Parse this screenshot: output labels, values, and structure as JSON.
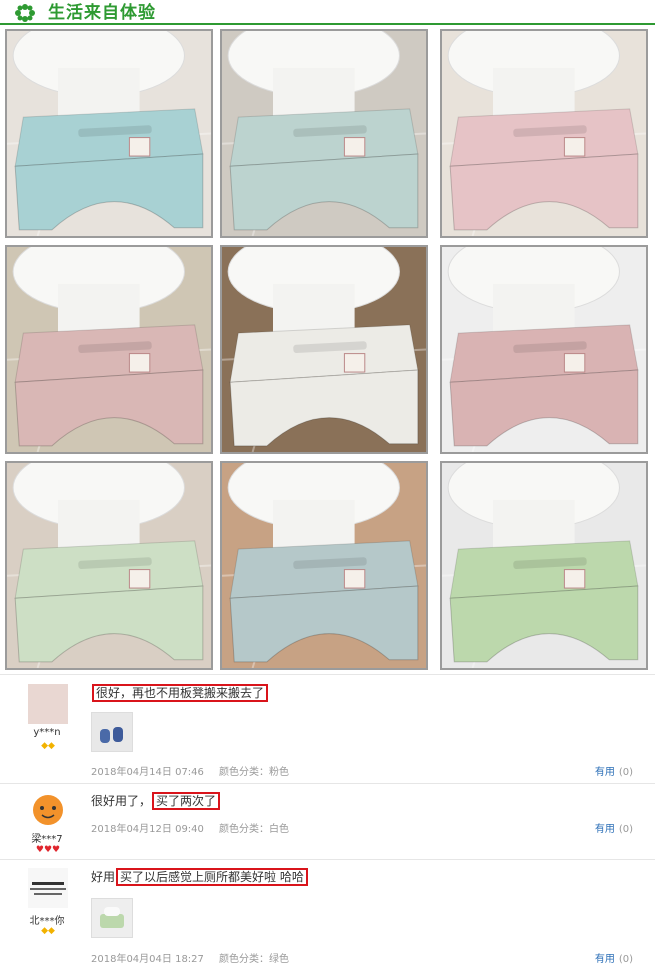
{
  "header": {
    "title": "生活来自体验",
    "accent": "#2e9a32"
  },
  "photos": [
    {
      "stool_color": "#a8d1d3",
      "floor": "#e7e2dc"
    },
    {
      "stool_color": "#bcd3cf",
      "floor": "#cfcac2"
    },
    {
      "stool_color": "#e6c3c6",
      "floor": "#e8e2da"
    },
    {
      "stool_color": "#d9b7b5",
      "floor": "#cfc6b4"
    },
    {
      "stool_color": "#ecebe6",
      "floor": "#8a7158"
    },
    {
      "stool_color": "#d9b3b3",
      "floor": "#eeeeee"
    },
    {
      "stool_color": "#cddfc5",
      "floor": "#d9cfc4"
    },
    {
      "stool_color": "#b5c8c9",
      "floor": "#c7a284"
    },
    {
      "stool_color": "#bcd8ac",
      "floor": "#e9e9e9"
    }
  ],
  "reviews": [
    {
      "user": "y***n",
      "gems": "◆◆",
      "gem_color": "#f2b200",
      "prefix": "",
      "highlight": "很好，再也不用板凳搬来搬去了",
      "date": "2018年04月14日 07:46",
      "color": "颜色分类：粉色",
      "useful": "有用",
      "count": "(0)"
    },
    {
      "user": "梁***7",
      "gems": "♥♥♥",
      "gem_color": "#e0262e",
      "prefix": "很好用了，",
      "highlight": "买了两次了",
      "date": "2018年04月12日 09:40",
      "color": "颜色分类：白色",
      "useful": "有用",
      "count": "(0)"
    },
    {
      "user": "北***你",
      "gems": "◆◆",
      "gem_color": "#f2b200",
      "prefix": "好用",
      "highlight": "买了以后感觉上厕所都美好啦 哈哈",
      "date": "2018年04月04日 18:27",
      "color": "颜色分类：绿色",
      "useful": "有用",
      "count": "(0)"
    }
  ]
}
